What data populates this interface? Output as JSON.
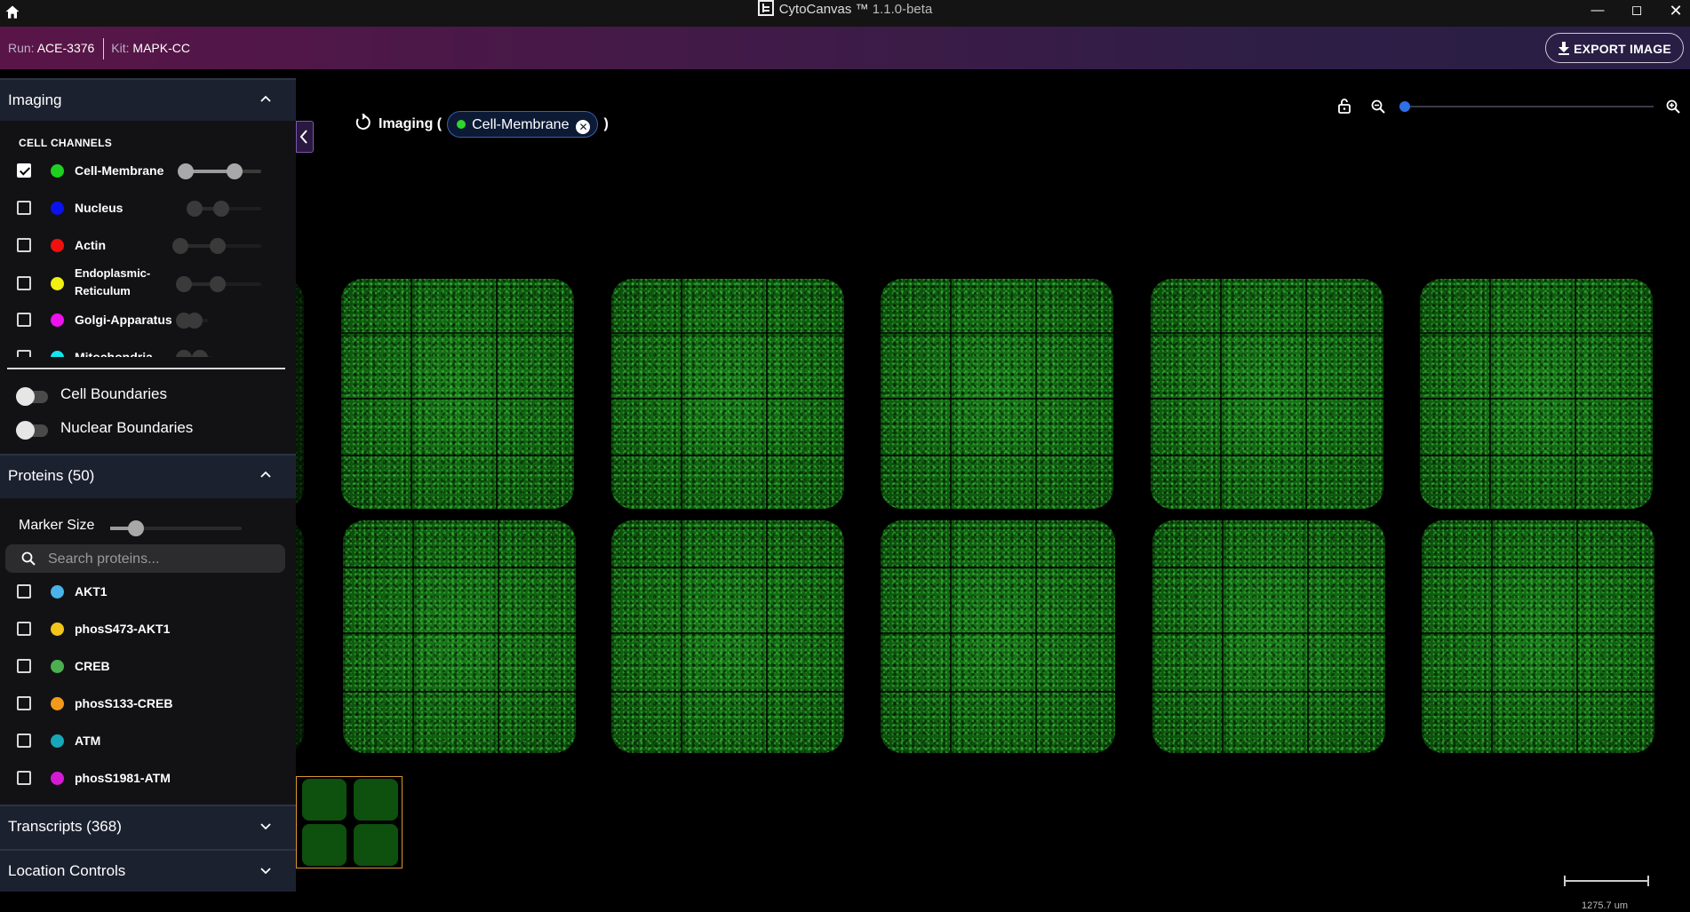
{
  "window": {
    "app_title": "CytoCanvas ™",
    "version": "1.1.0-beta"
  },
  "runbar": {
    "run_label": "Run:",
    "run_value": "ACE-3376",
    "kit_label": "Kit:",
    "kit_value": "MAPK-CC",
    "export_label": "EXPORT IMAGE"
  },
  "imaging": {
    "header": "Imaging",
    "channels_heading": "CELL CHANNELS",
    "channels": [
      {
        "label": "Cell-Membrane",
        "color": "#1fd11f",
        "checked": true
      },
      {
        "label": "Nucleus",
        "color": "#0a12ee",
        "checked": false
      },
      {
        "label": "Actin",
        "color": "#f01010",
        "checked": false
      },
      {
        "label": "Endoplasmic-",
        "label2": "Reticulum",
        "color": "#f2ef12",
        "checked": false
      },
      {
        "label": "Golgi-Apparatus",
        "color": "#ee12ee",
        "checked": false
      },
      {
        "label": "Mitochondria",
        "color": "#12e6ee",
        "checked": false
      }
    ],
    "toggles": [
      {
        "label": "Cell Boundaries",
        "on": false
      },
      {
        "label": "Nuclear Boundaries",
        "on": false
      }
    ]
  },
  "proteins": {
    "header": "Proteins (50)",
    "marker_size_label": "Marker Size",
    "search_placeholder": "Search proteins...",
    "items": [
      {
        "label": "AKT1",
        "color": "#49b3ea"
      },
      {
        "label": "phosS473-AKT1",
        "color": "#f3c51b"
      },
      {
        "label": "CREB",
        "color": "#4caf50"
      },
      {
        "label": "phosS133-CREB",
        "color": "#f39a1b"
      },
      {
        "label": "ATM",
        "color": "#17a7b8"
      },
      {
        "label": "phosS1981-ATM",
        "color": "#d51ad6"
      }
    ]
  },
  "transcripts": {
    "header": "Transcripts (368)"
  },
  "location": {
    "header": "Location Controls"
  },
  "breadcrumb": {
    "prefix": "Imaging (",
    "chip": "Cell-Membrane",
    "suffix": ")"
  },
  "scale_bar": {
    "label": "1275.7 um"
  },
  "colors": {
    "accent_blue": "#2f6fe8",
    "panel_header": "#1c2130",
    "minimap_border": "#d9962f"
  }
}
